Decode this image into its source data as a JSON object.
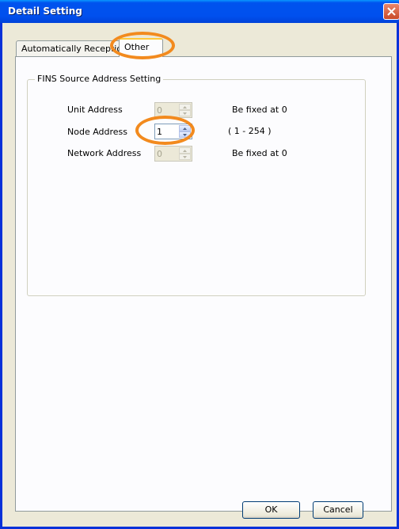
{
  "window": {
    "title": "Detail Setting"
  },
  "tabs": [
    {
      "label": "Automatically Reception"
    },
    {
      "label": "Other"
    }
  ],
  "group": {
    "title": "FINS Source Address Setting",
    "rows": [
      {
        "label": "Unit Address",
        "value": "0",
        "note": "Be fixed at 0",
        "enabled": false
      },
      {
        "label": "Node Address",
        "value": "1",
        "note": "( 1 - 254 )",
        "enabled": true
      },
      {
        "label": "Network Address",
        "value": "0",
        "note": "Be fixed at 0",
        "enabled": false
      }
    ]
  },
  "buttons": {
    "ok": "OK",
    "cancel": "Cancel"
  },
  "colors": {
    "titlebar": "#0054e3",
    "highlight_ring": "#f28a1e",
    "background": "#ece9d8"
  },
  "icons": {
    "close": "close-icon",
    "spin_up": "arrow-up-icon",
    "spin_down": "arrow-down-icon"
  }
}
